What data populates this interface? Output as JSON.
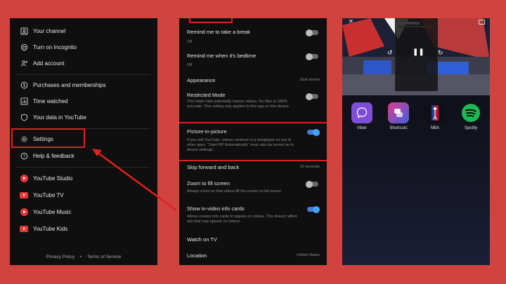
{
  "menu": {
    "items": [
      {
        "label": "Your channel",
        "icon": "account-icon"
      },
      {
        "label": "Turn on Incognito",
        "icon": "incognito-icon"
      },
      {
        "label": "Add account",
        "icon": "add-account-icon"
      },
      {
        "label": "Purchases and memberships",
        "icon": "dollar-icon"
      },
      {
        "label": "Time watched",
        "icon": "chart-icon"
      },
      {
        "label": "Your data in YouTube",
        "icon": "shield-icon"
      },
      {
        "label": "Settings",
        "icon": "gear-icon"
      },
      {
        "label": "Help & feedback",
        "icon": "help-icon"
      },
      {
        "label": "YouTube Studio",
        "icon": "youtube-studio-icon"
      },
      {
        "label": "YouTube TV",
        "icon": "youtube-tv-icon"
      },
      {
        "label": "YouTube Music",
        "icon": "youtube-music-icon"
      },
      {
        "label": "YouTube Kids",
        "icon": "youtube-kids-icon"
      }
    ],
    "footer": {
      "privacy": "Privacy Policy",
      "dot": "•",
      "terms": "Terms of Service"
    }
  },
  "settings": {
    "remind_break": {
      "title": "Remind me to take a break",
      "sub": "Off"
    },
    "remind_bedtime": {
      "title": "Remind me when it's bedtime",
      "sub": "Off"
    },
    "appearance": {
      "title": "Appearance",
      "value": "Dark theme"
    },
    "restricted": {
      "title": "Restricted Mode",
      "sub": "This helps hide potentially mature videos. No filter is 100% accurate. This setting only applies to this app on this device."
    },
    "pip": {
      "title": "Picture-in-picture",
      "sub": "If you exit YouTube, videos continue in a miniplayer on top of other apps. \"Start PiP Automatically\" must also be turned on in device settings.",
      "enabled": true
    },
    "skip": {
      "title": "Skip forward and back",
      "value": "10 seconds"
    },
    "zoom": {
      "title": "Zoom to fill screen",
      "sub": "Always zoom so that videos fill the screen in full screen",
      "enabled": false
    },
    "info_cards": {
      "title": "Show in-video info cards",
      "sub": "Allows creator info cards to appear on videos. This doesn't affect ads that may appear on videos.",
      "enabled": true
    },
    "watch_tv": {
      "title": "Watch on TV"
    },
    "location": {
      "title": "Location",
      "value": "United States"
    }
  },
  "phone": {
    "apps": [
      {
        "name": "Viber",
        "color": "#7d4fd6"
      },
      {
        "name": "Shortcuts",
        "color": "#c2185b"
      },
      {
        "name": "NBA",
        "color": "#ffffff"
      },
      {
        "name": "Spotify",
        "color": "#1db954"
      }
    ],
    "pip_play": "❚❚",
    "skip_back": "↺",
    "skip_fwd": "↻",
    "close": "✕"
  }
}
